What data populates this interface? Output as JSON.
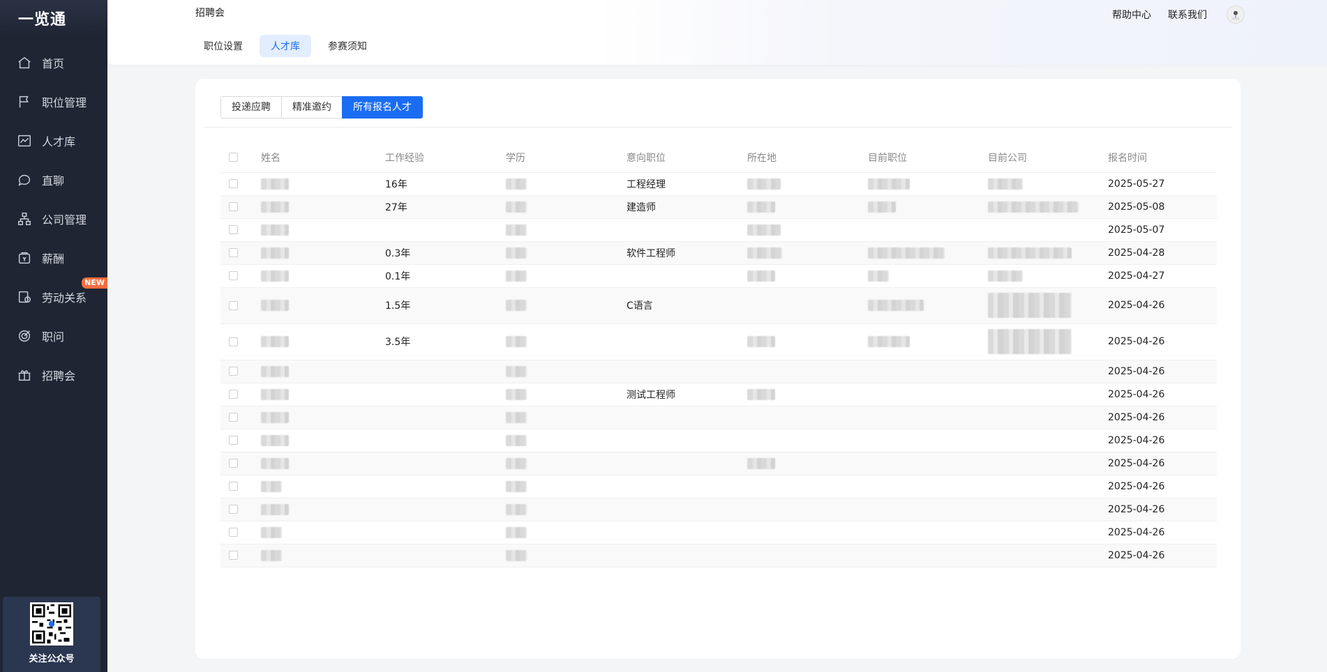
{
  "sidebar": {
    "logo": "一览通",
    "items": [
      {
        "label": "首页",
        "icon": "home-icon"
      },
      {
        "label": "职位管理",
        "icon": "flag-icon"
      },
      {
        "label": "人才库",
        "icon": "chart-line-icon"
      },
      {
        "label": "直聊",
        "icon": "chat-icon"
      },
      {
        "label": "公司管理",
        "icon": "org-chart-icon"
      },
      {
        "label": "薪酬",
        "icon": "wallet-icon"
      },
      {
        "label": "劳动关系",
        "icon": "contract-icon",
        "badge": "NEW"
      },
      {
        "label": "职问",
        "icon": "target-icon"
      },
      {
        "label": "招聘会",
        "icon": "gift-icon"
      }
    ],
    "qr_label": "关注公众号"
  },
  "header": {
    "breadcrumb": "招聘会",
    "help": "帮助中心",
    "contact": "联系我们",
    "tabs": [
      "职位设置",
      "人才库",
      "参赛须知"
    ],
    "active_tab": 1
  },
  "segments": [
    "投递应聘",
    "精准邀约",
    "所有报名人才"
  ],
  "active_segment": 2,
  "table": {
    "columns": [
      "姓名",
      "工作经验",
      "学历",
      "意向职位",
      "所在地",
      "目前职位",
      "目前公司",
      "报名时间"
    ],
    "rows": [
      {
        "exp": "16年",
        "pos": "工程经理",
        "date": "2025-05-27",
        "tall": false
      },
      {
        "exp": "27年",
        "pos": "建造师",
        "date": "2025-05-08",
        "tall": false
      },
      {
        "exp": "",
        "pos": "",
        "date": "2025-05-07",
        "tall": false
      },
      {
        "exp": "0.3年",
        "pos": "软件工程师",
        "date": "2025-04-28",
        "tall": false
      },
      {
        "exp": "0.1年",
        "pos": "",
        "date": "2025-04-27",
        "tall": false
      },
      {
        "exp": "1.5年",
        "pos": "C语言",
        "date": "2025-04-26",
        "tall": true
      },
      {
        "exp": "3.5年",
        "pos": "",
        "date": "2025-04-26",
        "tall": true
      },
      {
        "exp": "",
        "pos": "",
        "date": "2025-04-26",
        "tall": false
      },
      {
        "exp": "",
        "pos": "测试工程师",
        "date": "2025-04-26",
        "tall": false
      },
      {
        "exp": "",
        "pos": "",
        "date": "2025-04-26",
        "tall": false
      },
      {
        "exp": "",
        "pos": "",
        "date": "2025-04-26",
        "tall": false
      },
      {
        "exp": "",
        "pos": "",
        "date": "2025-04-26",
        "tall": false
      },
      {
        "exp": "",
        "pos": "",
        "date": "2025-04-26",
        "tall": false
      },
      {
        "exp": "",
        "pos": "",
        "date": "2025-04-26",
        "tall": false
      },
      {
        "exp": "",
        "pos": "",
        "date": "2025-04-26",
        "tall": false
      },
      {
        "exp": "",
        "pos": "",
        "date": "2025-04-26",
        "tall": false
      }
    ]
  },
  "colors": {
    "accent": "#1a6df3",
    "sidebar_bg": "#1f2533",
    "badge": "#f56c3f"
  }
}
